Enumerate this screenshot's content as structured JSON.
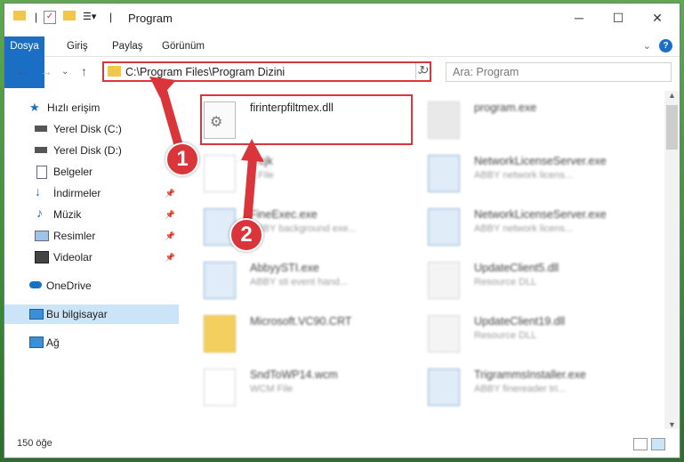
{
  "window": {
    "title": "Program"
  },
  "ribbon": {
    "tabs": [
      "Dosya",
      "Giriş",
      "Paylaş",
      "Görünüm"
    ]
  },
  "address": {
    "path": "C:\\Program Files\\Program Dizini"
  },
  "search": {
    "placeholder": "Ara: Program"
  },
  "nav": {
    "items": [
      "Hızlı erişim",
      "Yerel Disk (C:)",
      "Yerel Disk (D:)",
      "Belgeler",
      "İndirmeler",
      "Müzik",
      "Resimler",
      "Videolar",
      "OneDrive",
      "Bu bilgisayar",
      "Ağ"
    ]
  },
  "files": [
    {
      "name": "firinterpfiltmex.dll",
      "sub": ""
    },
    {
      "name": "program.exe",
      "sub": ""
    },
    {
      "name": "...cjk",
      "sub": "...File"
    },
    {
      "name": "NetworkLicenseServer.exe",
      "sub": "ABBY network licens..."
    },
    {
      "name": "FineExec.exe",
      "sub": "ABBY background exe..."
    },
    {
      "name": "NetworkLicenseServer.exe",
      "sub": "ABBY network licens..."
    },
    {
      "name": "AbbyySTI.exe",
      "sub": "ABBY sti event hand..."
    },
    {
      "name": "UpdateClient5.dll",
      "sub": "Resource DLL"
    },
    {
      "name": "Microsoft.VC90.CRT",
      "sub": ""
    },
    {
      "name": "UpdateClient19.dll",
      "sub": "Resource DLL"
    },
    {
      "name": "SndToWP14.wcm",
      "sub": "WCM File"
    },
    {
      "name": "TrigrammsInstaller.exe",
      "sub": "ABBY finereader tri..."
    }
  ],
  "status": {
    "count": "150 öğe"
  },
  "annotations": {
    "badge1": "1",
    "badge2": "2"
  },
  "colors": {
    "accent": "#1a6fc4",
    "highlight": "#d9353a",
    "selection": "#cce4f7"
  }
}
